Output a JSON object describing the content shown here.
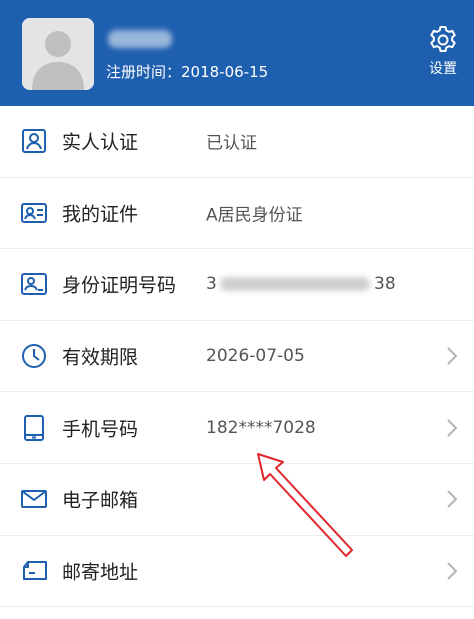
{
  "header": {
    "registration_text": "注册时间：2018-06-15",
    "settings_label": "设置",
    "background_color": "#1e5fb0"
  },
  "rows": [
    {
      "label": "实人认证",
      "value": "已认证",
      "icon": "person-card-icon",
      "has_chevron": false
    },
    {
      "label": "我的证件",
      "value": "A居民身份证",
      "icon": "id-card-icon",
      "has_chevron": false
    },
    {
      "label": "身份证明号码",
      "value_first": "3",
      "value_last": "38",
      "icon": "id-number-icon",
      "has_chevron": false
    },
    {
      "label": "有效期限",
      "value": "2026-07-05",
      "icon": "clock-icon",
      "has_chevron": true
    },
    {
      "label": "手机号码",
      "value": "182****7028",
      "icon": "phone-icon",
      "has_chevron": true
    },
    {
      "label": "电子邮箱",
      "value": "",
      "icon": "mail-icon",
      "has_chevron": true
    },
    {
      "label": "邮寄地址",
      "value": "",
      "icon": "mailing-address-icon",
      "has_chevron": true
    }
  ],
  "colors": {
    "icon_blue": "#1e5fb0",
    "annotation_red": "#e0252b"
  }
}
